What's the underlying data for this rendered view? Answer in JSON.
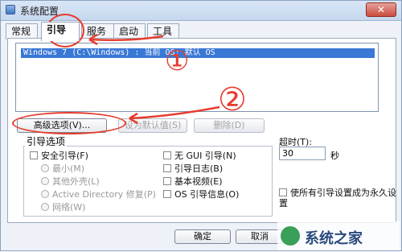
{
  "window": {
    "title": "系统配置",
    "close_glyph": "✕"
  },
  "tabs": [
    "常规",
    "引导",
    "服务",
    "启动",
    "工具"
  ],
  "os_list": {
    "entry": "Windows 7 (C:\\Windows) : 当前 OS; 默认 OS"
  },
  "buttons": {
    "advanced": "高级选项(V)...",
    "set_default": "设为默认值(S)",
    "delete": "删除(D)",
    "ok": "确定",
    "cancel": "取消"
  },
  "boot_options": {
    "title": "引导选项",
    "safe_boot": "安全引导(F)",
    "minimal": "最小(M)",
    "alternate_shell": "其他外壳(L)",
    "ad_repair": "Active Directory 修复(P)",
    "network": "网络(W)",
    "no_gui": "无 GUI 引导(N)",
    "boot_log": "引导日志(B)",
    "base_video": "基本视频(E)",
    "os_info": "OS 引导信息(O)"
  },
  "timeout": {
    "label": "超时(T):",
    "value": "30",
    "unit": "秒"
  },
  "permanent": "使所有引导设置成为永久设置",
  "annotations": {
    "one": "①",
    "two": "②"
  },
  "watermark": {
    "text": "系统之家"
  },
  "colors": {
    "annotation": "#e63c2e",
    "selection": "#3a78d6"
  }
}
